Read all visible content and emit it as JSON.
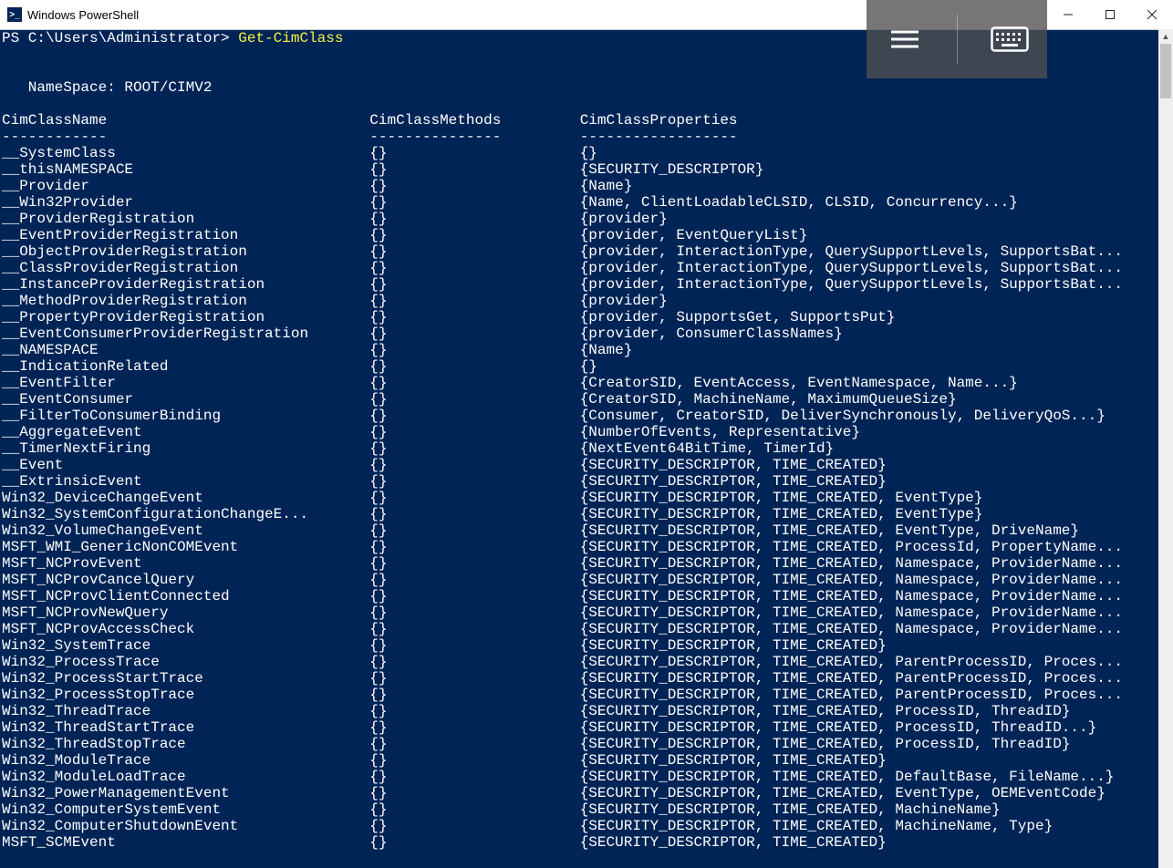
{
  "window": {
    "title": "Windows PowerShell",
    "icon_label": ">_"
  },
  "prompt": {
    "path": "PS C:\\Users\\Administrator> ",
    "command": "Get-CimClass"
  },
  "namespace_line": "   NameSpace: ROOT/CIMV2",
  "headers": {
    "col1": "CimClassName",
    "col2": "CimClassMethods",
    "col3": "CimClassProperties"
  },
  "dashes": {
    "col1": "------------",
    "col2": "---------------",
    "col3": "------------------"
  },
  "rows": [
    {
      "name": "__SystemClass",
      "methods": "{}",
      "props": "{}"
    },
    {
      "name": "__thisNAMESPACE",
      "methods": "{}",
      "props": "{SECURITY_DESCRIPTOR}"
    },
    {
      "name": "__Provider",
      "methods": "{}",
      "props": "{Name}"
    },
    {
      "name": "__Win32Provider",
      "methods": "{}",
      "props": "{Name, ClientLoadableCLSID, CLSID, Concurrency...}"
    },
    {
      "name": "__ProviderRegistration",
      "methods": "{}",
      "props": "{provider}"
    },
    {
      "name": "__EventProviderRegistration",
      "methods": "{}",
      "props": "{provider, EventQueryList}"
    },
    {
      "name": "__ObjectProviderRegistration",
      "methods": "{}",
      "props": "{provider, InteractionType, QuerySupportLevels, SupportsBat..."
    },
    {
      "name": "__ClassProviderRegistration",
      "methods": "{}",
      "props": "{provider, InteractionType, QuerySupportLevels, SupportsBat..."
    },
    {
      "name": "__InstanceProviderRegistration",
      "methods": "{}",
      "props": "{provider, InteractionType, QuerySupportLevels, SupportsBat..."
    },
    {
      "name": "__MethodProviderRegistration",
      "methods": "{}",
      "props": "{provider}"
    },
    {
      "name": "__PropertyProviderRegistration",
      "methods": "{}",
      "props": "{provider, SupportsGet, SupportsPut}"
    },
    {
      "name": "__EventConsumerProviderRegistration",
      "methods": "{}",
      "props": "{provider, ConsumerClassNames}"
    },
    {
      "name": "__NAMESPACE",
      "methods": "{}",
      "props": "{Name}"
    },
    {
      "name": "__IndicationRelated",
      "methods": "{}",
      "props": "{}"
    },
    {
      "name": "__EventFilter",
      "methods": "{}",
      "props": "{CreatorSID, EventAccess, EventNamespace, Name...}"
    },
    {
      "name": "__EventConsumer",
      "methods": "{}",
      "props": "{CreatorSID, MachineName, MaximumQueueSize}"
    },
    {
      "name": "__FilterToConsumerBinding",
      "methods": "{}",
      "props": "{Consumer, CreatorSID, DeliverSynchronously, DeliveryQoS...}"
    },
    {
      "name": "__AggregateEvent",
      "methods": "{}",
      "props": "{NumberOfEvents, Representative}"
    },
    {
      "name": "__TimerNextFiring",
      "methods": "{}",
      "props": "{NextEvent64BitTime, TimerId}"
    },
    {
      "name": "__Event",
      "methods": "{}",
      "props": "{SECURITY_DESCRIPTOR, TIME_CREATED}"
    },
    {
      "name": "__ExtrinsicEvent",
      "methods": "{}",
      "props": "{SECURITY_DESCRIPTOR, TIME_CREATED}"
    },
    {
      "name": "Win32_DeviceChangeEvent",
      "methods": "{}",
      "props": "{SECURITY_DESCRIPTOR, TIME_CREATED, EventType}"
    },
    {
      "name": "Win32_SystemConfigurationChangeE...",
      "methods": "{}",
      "props": "{SECURITY_DESCRIPTOR, TIME_CREATED, EventType}"
    },
    {
      "name": "Win32_VolumeChangeEvent",
      "methods": "{}",
      "props": "{SECURITY_DESCRIPTOR, TIME_CREATED, EventType, DriveName}"
    },
    {
      "name": "MSFT_WMI_GenericNonCOMEvent",
      "methods": "{}",
      "props": "{SECURITY_DESCRIPTOR, TIME_CREATED, ProcessId, PropertyName..."
    },
    {
      "name": "MSFT_NCProvEvent",
      "methods": "{}",
      "props": "{SECURITY_DESCRIPTOR, TIME_CREATED, Namespace, ProviderName..."
    },
    {
      "name": "MSFT_NCProvCancelQuery",
      "methods": "{}",
      "props": "{SECURITY_DESCRIPTOR, TIME_CREATED, Namespace, ProviderName..."
    },
    {
      "name": "MSFT_NCProvClientConnected",
      "methods": "{}",
      "props": "{SECURITY_DESCRIPTOR, TIME_CREATED, Namespace, ProviderName..."
    },
    {
      "name": "MSFT_NCProvNewQuery",
      "methods": "{}",
      "props": "{SECURITY_DESCRIPTOR, TIME_CREATED, Namespace, ProviderName..."
    },
    {
      "name": "MSFT_NCProvAccessCheck",
      "methods": "{}",
      "props": "{SECURITY_DESCRIPTOR, TIME_CREATED, Namespace, ProviderName..."
    },
    {
      "name": "Win32_SystemTrace",
      "methods": "{}",
      "props": "{SECURITY_DESCRIPTOR, TIME_CREATED}"
    },
    {
      "name": "Win32_ProcessTrace",
      "methods": "{}",
      "props": "{SECURITY_DESCRIPTOR, TIME_CREATED, ParentProcessID, Proces..."
    },
    {
      "name": "Win32_ProcessStartTrace",
      "methods": "{}",
      "props": "{SECURITY_DESCRIPTOR, TIME_CREATED, ParentProcessID, Proces..."
    },
    {
      "name": "Win32_ProcessStopTrace",
      "methods": "{}",
      "props": "{SECURITY_DESCRIPTOR, TIME_CREATED, ParentProcessID, Proces..."
    },
    {
      "name": "Win32_ThreadTrace",
      "methods": "{}",
      "props": "{SECURITY_DESCRIPTOR, TIME_CREATED, ProcessID, ThreadID}"
    },
    {
      "name": "Win32_ThreadStartTrace",
      "methods": "{}",
      "props": "{SECURITY_DESCRIPTOR, TIME_CREATED, ProcessID, ThreadID...}"
    },
    {
      "name": "Win32_ThreadStopTrace",
      "methods": "{}",
      "props": "{SECURITY_DESCRIPTOR, TIME_CREATED, ProcessID, ThreadID}"
    },
    {
      "name": "Win32_ModuleTrace",
      "methods": "{}",
      "props": "{SECURITY_DESCRIPTOR, TIME_CREATED}"
    },
    {
      "name": "Win32_ModuleLoadTrace",
      "methods": "{}",
      "props": "{SECURITY_DESCRIPTOR, TIME_CREATED, DefaultBase, FileName...}"
    },
    {
      "name": "Win32_PowerManagementEvent",
      "methods": "{}",
      "props": "{SECURITY_DESCRIPTOR, TIME_CREATED, EventType, OEMEventCode}"
    },
    {
      "name": "Win32_ComputerSystemEvent",
      "methods": "{}",
      "props": "{SECURITY_DESCRIPTOR, TIME_CREATED, MachineName}"
    },
    {
      "name": "Win32_ComputerShutdownEvent",
      "methods": "{}",
      "props": "{SECURITY_DESCRIPTOR, TIME_CREATED, MachineName, Type}"
    },
    {
      "name": "MSFT_SCMEvent",
      "methods": "{}",
      "props": "{SECURITY_DESCRIPTOR, TIME_CREATED}"
    }
  ],
  "layout": {
    "col1_width": 42,
    "col2_width": 24
  }
}
